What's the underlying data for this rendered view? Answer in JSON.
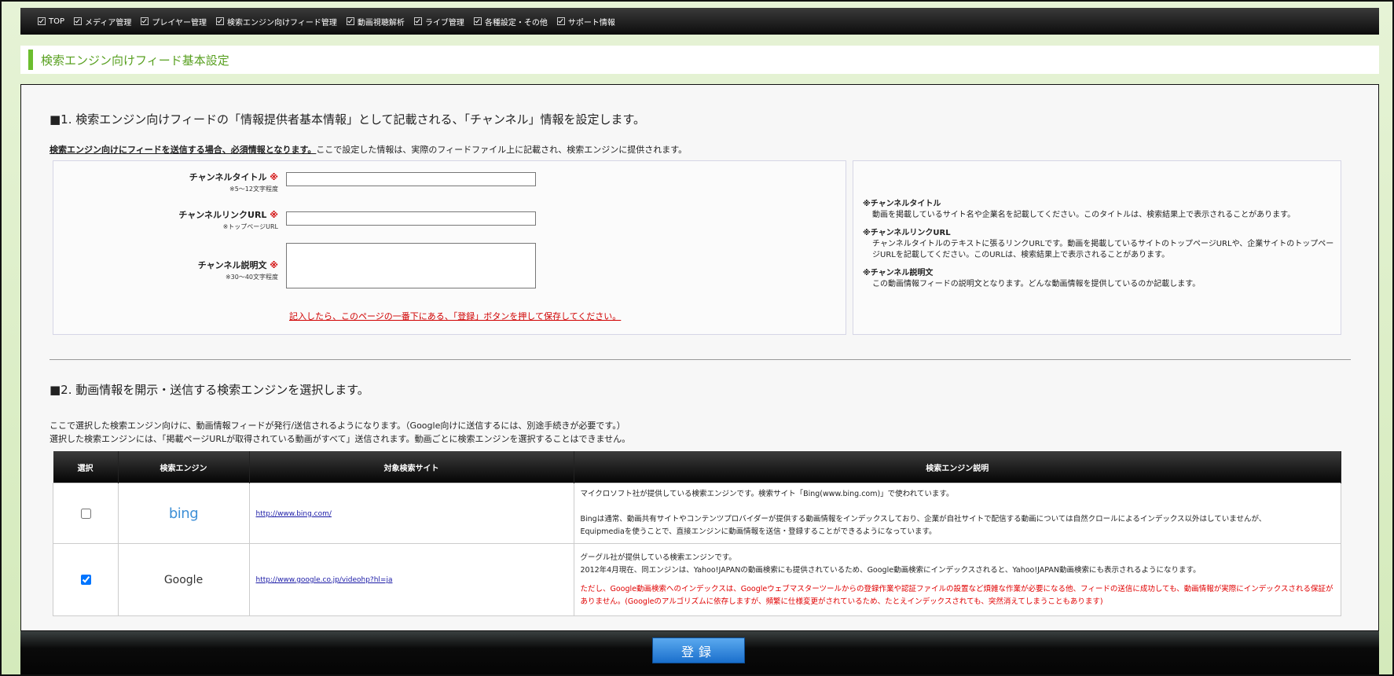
{
  "nav": {
    "items": [
      {
        "label": "TOP"
      },
      {
        "label": "メディア管理"
      },
      {
        "label": "プレイヤー管理"
      },
      {
        "label": "検索エンジン向けフィード管理"
      },
      {
        "label": "動画視聴解析"
      },
      {
        "label": "ライブ管理"
      },
      {
        "label": "各種設定・その他"
      },
      {
        "label": "サポート情報"
      }
    ]
  },
  "page": {
    "title": "検索エンジン向けフィード基本設定"
  },
  "section1": {
    "heading": "■1. 検索エンジン向けフィードの「情報提供者基本情報」として記載される、「チャンネル」情報を設定します。",
    "note_strong": "検索エンジン向けにフィードを送信する場合、必須情報となります。",
    "note_rest": "ここで設定した情報は、実際のフィードファイル上に記載され、検索エンジンに提供されます。",
    "fields": {
      "title_label": "チャンネルタイトル",
      "title_hint": "※5～12文字程度",
      "title_value": "",
      "url_label": "チャンネルリンクURL",
      "url_hint": "※トップページURL",
      "url_value": "",
      "desc_label": "チャンネル説明文",
      "desc_hint": "※30～40文字程度",
      "desc_value": "",
      "required_mark": "※"
    },
    "save_note": "記入したら、このページの一番下にある、「登録」ボタンを押して保存してください。",
    "help": [
      {
        "head": "※チャンネルタイトル",
        "body": "動画を掲載しているサイト名や企業名を記載してください。このタイトルは、検索結果上で表示されることがあります。"
      },
      {
        "head": "※チャンネルリンクURL",
        "body": "チャンネルタイトルのテキストに張るリンクURLです。動画を掲載しているサイトのトップページURLや、企業サイトのトップページURLを記載してください。このURLは、検索結果上で表示されることがあります。"
      },
      {
        "head": "※チャンネル説明文",
        "body": "この動画情報フィードの説明文となります。どんな動画情報を提供しているのか記載します。"
      }
    ]
  },
  "section2": {
    "heading": "■2. 動画情報を開示・送信する検索エンジンを選択します。",
    "note_line1": "ここで選択した検索エンジン向けに、動画情報フィードが発行/送信されるようになります。（Google向けに送信するには、別途手続きが必要です。）",
    "note_line2": "選択した検索エンジンには、「掲載ページURLが取得されている動画がすべて」送信されます。動画ごとに検索エンジンを選択することはできません。",
    "table": {
      "headers": [
        "選択",
        "検索エンジン",
        "対象検索サイト",
        "検索エンジン説明"
      ],
      "rows": [
        {
          "checked": false,
          "engine": "bing",
          "site": "http://www.bing.com/",
          "desc1": "マイクロソフト社が提供している検索エンジンです。検索サイト「Bing(www.bing.com)」で使われています。",
          "desc2": "Bingは通常、動画共有サイトやコンテンツプロバイダーが提供する動画情報をインデックスしており、企業が自社サイトで配信する動画については自然クロールによるインデックス以外はしていませんが、",
          "desc3": "Equipmediaを使うことで、直接エンジンに動画情報を送信・登録することができるようになっています。"
        },
        {
          "checked": true,
          "engine": "Google",
          "site": "http://www.google.co.jp/videohp?hl=ja",
          "desc1": "グーグル社が提供している検索エンジンです。",
          "desc2": "2012年4月現在、同エンジンは、Yahoo!JAPANの動画検索にも提供されているため、Google動画検索にインデックスされると、Yahoo!JAPAN動画検索にも表示されるようになります。",
          "desc_red": "ただし、Google動画検索へのインデックスは、Googleウェブマスターツールからの登録作業や認証ファイルの設置など煩雑な作業が必要になる他、フィードの送信に成功しても、動画情報が実際にインデックスされる保証がありません。(Googleのアルゴリズムに依存しますが、頻繁に仕様変更がされているため、たとえインデックスされても、突然消えてしまうこともあります)"
        }
      ]
    }
  },
  "footer": {
    "register_label": "登録"
  },
  "colors": {
    "accent_green": "#6cbd2f",
    "required_red": "#d00000",
    "button_blue": "#1a6fcc"
  }
}
